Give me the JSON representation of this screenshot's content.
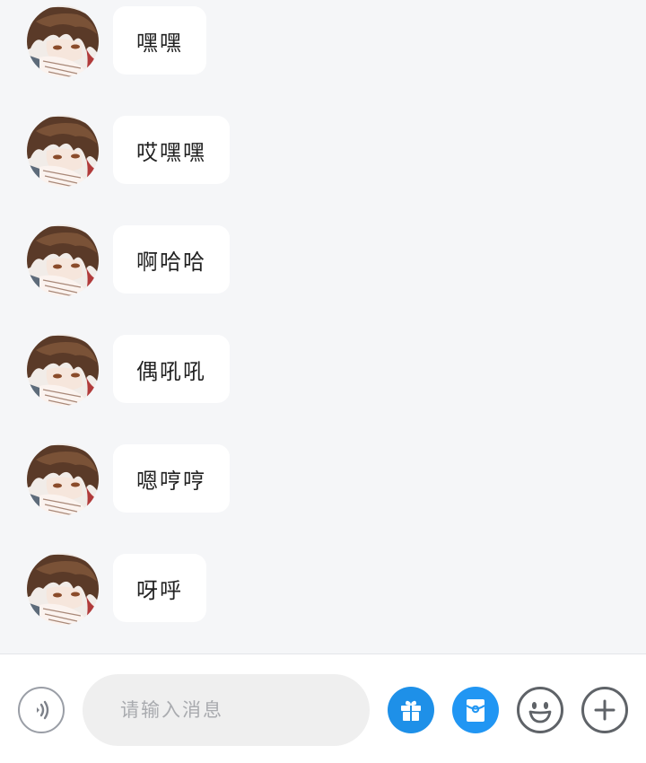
{
  "messages": [
    {
      "text": "嘿嘿"
    },
    {
      "text": "哎嘿嘿"
    },
    {
      "text": "啊哈哈"
    },
    {
      "text": "偶吼吼"
    },
    {
      "text": "嗯哼哼"
    },
    {
      "text": "呀呼"
    }
  ],
  "input_bar": {
    "placeholder": "请输入消息",
    "value": "",
    "icons": {
      "voice": "voice-icon",
      "gift": "gift-icon",
      "red_packet": "red-packet-icon",
      "emoji": "smiley-icon",
      "more": "plus-icon"
    }
  },
  "colors": {
    "background": "#f5f6f8",
    "bubble": "#ffffff",
    "accent_blue": "#1e90e8",
    "icon_gray": "#5f6368"
  }
}
